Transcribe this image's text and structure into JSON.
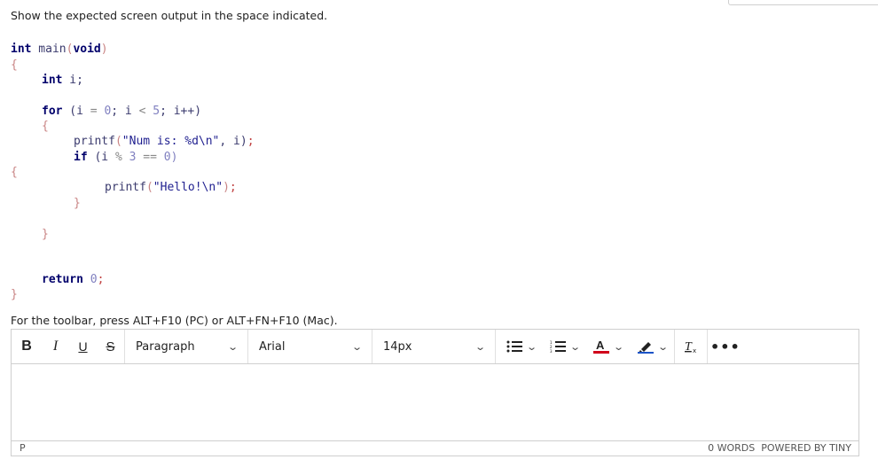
{
  "prompt": "Show the expected screen output in the space indicated.",
  "code": {
    "main_sig_kw": "int",
    "main_sig_name": " main",
    "main_sig_open": "(",
    "main_sig_void": "void",
    "main_sig_close": ")",
    "brace_open": "{",
    "decl_kw": "int",
    "decl_rest": " i;",
    "for_kw": "for",
    "for_rest_1": " (i ",
    "for_eq": "=",
    "for_zero": " 0",
    "for_rest_2": "; i ",
    "for_lt": "<",
    "for_five": " 5",
    "for_rest_3": "; i++)",
    "printf1_name": "printf",
    "printf1_open": "(",
    "printf1_str": "\"Num is: %d\\n\"",
    "printf1_rest": ", i)",
    "printf1_semi": ";",
    "if_kw": "if",
    "if_rest_1": " (i ",
    "if_mod": "%",
    "if_three": " 3",
    "if_eq": " ==",
    "if_zero": " 0)",
    "brace_open_2": "{",
    "printf2_name": "printf",
    "printf2_open": "(",
    "printf2_str": "\"Hello!\\n\"",
    "printf2_close": ")",
    "printf2_semi": ";",
    "brace_close_1": "}",
    "brace_close_2": "}",
    "return_kw": "return",
    "return_zero": " 0",
    "return_semi": ";",
    "brace_close_3": "}"
  },
  "hint": "For the toolbar, press ALT+F10 (PC) or ALT+FN+F10 (Mac).",
  "toolbar": {
    "bold": "B",
    "italic": "I",
    "underline": "U",
    "strike": "S",
    "block_format": "Paragraph",
    "font_family": "Arial",
    "font_size": "14px",
    "bullet_list_icon": "bullet-list-icon",
    "numbered_list_icon": "numbered-list-icon",
    "text_color_icon": "text-color-icon",
    "highlight_icon": "highlight-icon",
    "clear_format_icon": "clear-formatting-icon",
    "more_icon": "more-icon",
    "accent_red": "#d0021b",
    "accent_blue": "#1a53c7"
  },
  "status": {
    "path": "P",
    "words": "0 WORDS",
    "powered": "POWERED BY TINY"
  }
}
